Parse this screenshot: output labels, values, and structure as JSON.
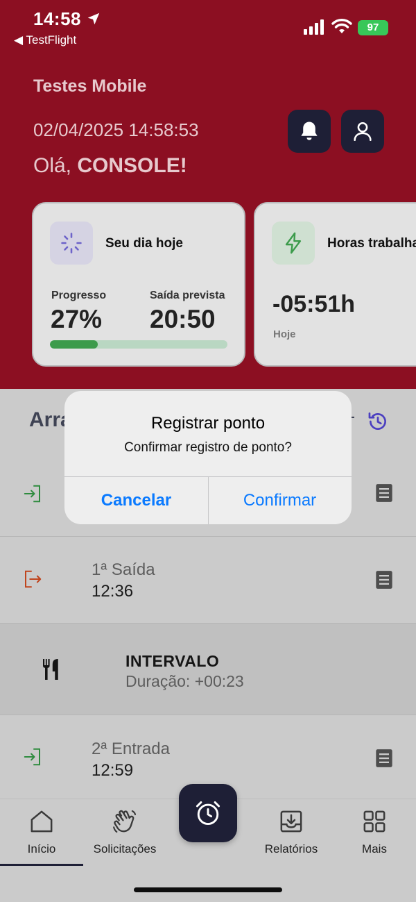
{
  "status_bar": {
    "time": "14:58",
    "back_app": "◀ TestFlight",
    "battery": "97"
  },
  "header": {
    "app_title": "Testes Mobile",
    "datetime": "02/04/2025 14:58:53",
    "greeting_prefix": "Olá, ",
    "greeting_name": "CONSOLE!"
  },
  "cards": {
    "today": {
      "title": "Seu dia hoje",
      "progress_label": "Progresso",
      "progress_value": "27%",
      "progress_fraction": 0.27,
      "exit_label": "Saída prevista",
      "exit_value": "20:50"
    },
    "hours": {
      "title": "Horas trabalha",
      "value": "-05:51h",
      "sub": "Hoje"
    }
  },
  "section": {
    "title": "Arra"
  },
  "entries": [
    {
      "name": "1ª Saída",
      "time": "12:36"
    },
    {
      "name": "2ª Entrada",
      "time": "12:59"
    }
  ],
  "interval": {
    "label": "INTERVALO",
    "duration": "Duração: +00:23"
  },
  "dialog": {
    "title": "Registrar ponto",
    "message": "Confirmar registro de ponto?",
    "cancel": "Cancelar",
    "confirm": "Confirmar"
  },
  "tabs": [
    {
      "label": "Início",
      "icon": "home-icon",
      "active": true
    },
    {
      "label": "Solicitações",
      "icon": "hand-wave-icon",
      "active": false
    },
    {
      "label": "Relatórios",
      "icon": "download-tray-icon",
      "active": false
    },
    {
      "label": "Mais",
      "icon": "grid-icon",
      "active": false
    }
  ],
  "colors": {
    "header_bg": "#8c0f22",
    "dark_button": "#1e1f36",
    "accent_blue": "#0a7aff",
    "progress_green": "#3c9b4b",
    "entry_green": "#2e8b3e",
    "exit_orange": "#c0451e"
  }
}
